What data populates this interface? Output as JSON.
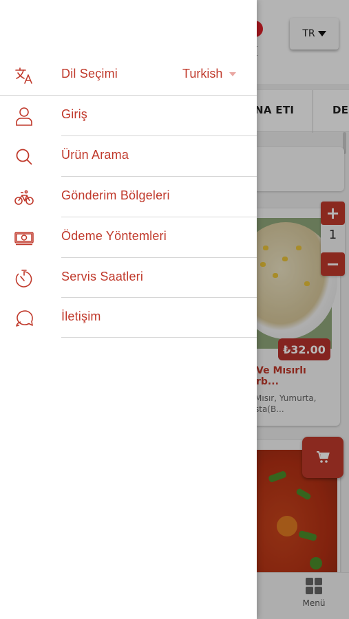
{
  "colors": {
    "accent": "#c0392b",
    "drawer_bg": "#ffffff",
    "separator": "#d6d6d6"
  },
  "header": {
    "language_button": "TR"
  },
  "tabs": [
    {
      "label": "NA ETI"
    },
    {
      "label": "DE"
    }
  ],
  "products": [
    {
      "price": "₺32.00",
      "title_line1": "Ve Mısırlı",
      "title_line2": "rb...",
      "desc_line1": "Mısır, Yumurta,",
      "desc_line2": "sta(B...",
      "quantity": "1"
    }
  ],
  "quantity_controls": {
    "plus": "+",
    "minus": "−"
  },
  "bottom_nav": {
    "menu_label": "Menü"
  },
  "drawer": {
    "language": {
      "label": "Dil Seçimi",
      "value": "Turkish",
      "icon": "translate-icon"
    },
    "items": [
      {
        "label": "Giriş",
        "icon": "user-icon"
      },
      {
        "label": "Ürün Arama",
        "icon": "search-icon"
      },
      {
        "label": "Gönderim Bölgeleri",
        "icon": "bicycle-icon"
      },
      {
        "label": "Ödeme Yöntemleri",
        "icon": "money-icon"
      },
      {
        "label": "Servis Saatleri",
        "icon": "timer-icon"
      },
      {
        "label": "İletişim",
        "icon": "chat-icon"
      }
    ]
  }
}
